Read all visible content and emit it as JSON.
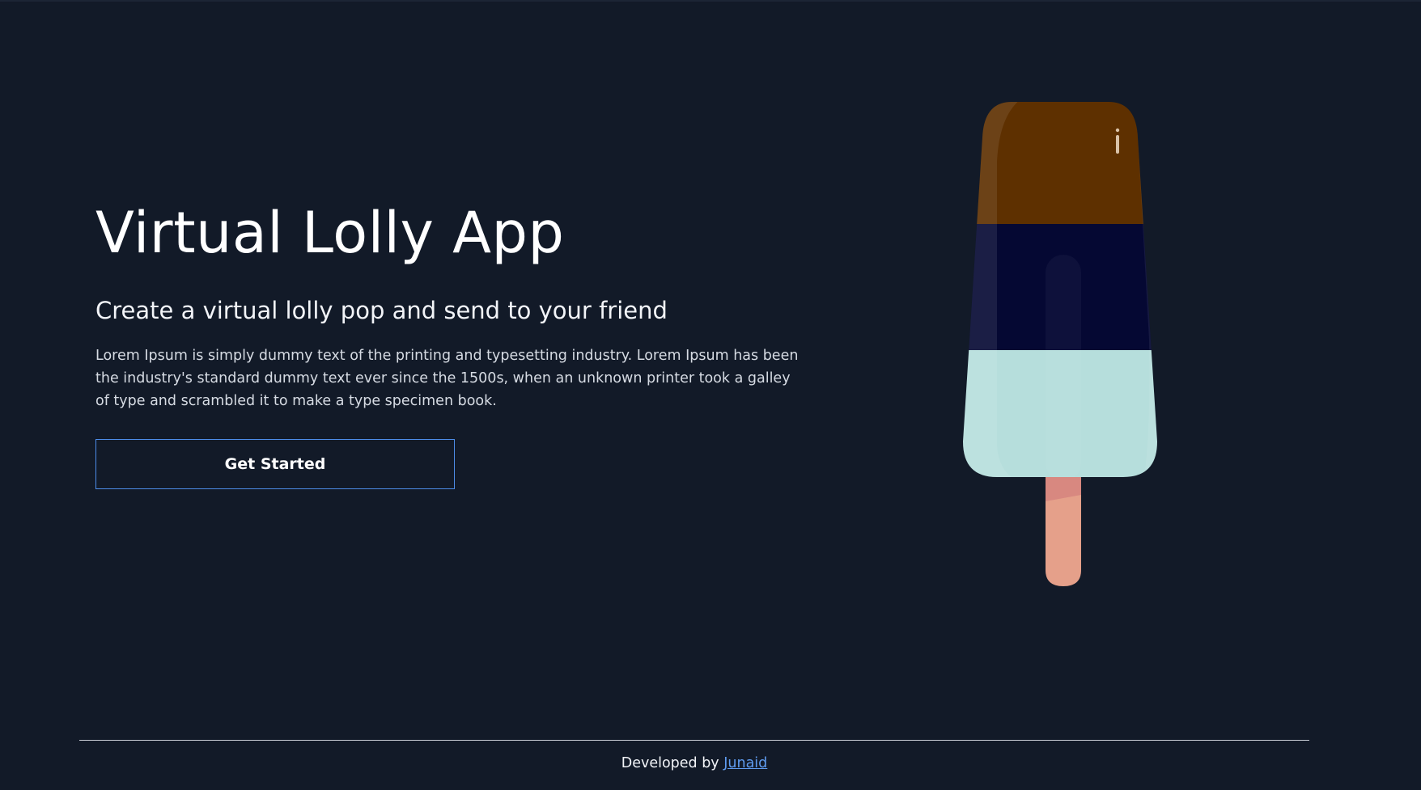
{
  "hero": {
    "title": "Virtual Lolly App",
    "subtitle": "Create a virtual lolly pop and send to your friend",
    "description": "Lorem Ipsum is simply dummy text of the printing and typesetting industry. Lorem Ipsum has been the industry's standard dummy text ever since the 1500s, when an unknown printer took a galley of type and scrambled it to make a type specimen book.",
    "cta_label": "Get Started"
  },
  "lolly": {
    "flavour_top_color": "#5e3000",
    "flavour_middle_color": "#050833",
    "flavour_bottom_color": "#b6dedc",
    "stick_color": "#e5a08a"
  },
  "footer": {
    "prefix": "Developed by",
    "author": "Junaid"
  },
  "colors": {
    "background": "#121a28",
    "accent": "#4d8ce8",
    "link": "#5f9cf0"
  }
}
